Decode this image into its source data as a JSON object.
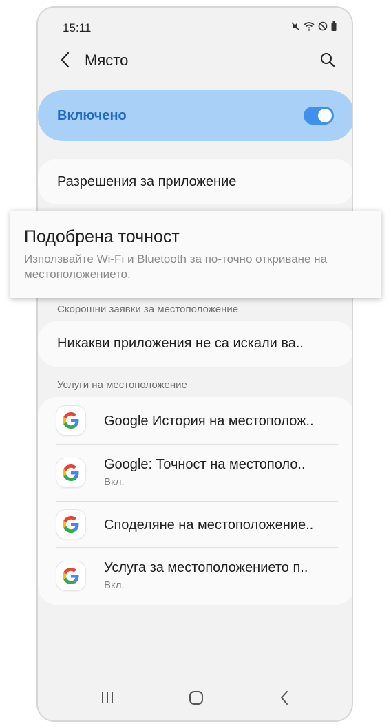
{
  "status_bar": {
    "time": "15:11",
    "icons": [
      "mute-icon",
      "wifi-icon",
      "block-icon",
      "battery-icon"
    ]
  },
  "header": {
    "title": "Място",
    "back_icon": "chevron-left-icon",
    "search_icon": "search-icon"
  },
  "master_switch": {
    "label": "Включено",
    "state": true,
    "accent_color": "#3e91ec",
    "background_color": "#a9d0f7"
  },
  "app_permissions": {
    "label": "Разрешения за приложение"
  },
  "improve_accuracy": {
    "title": "Подобрена точност",
    "subtitle": "Използвайте Wi-Fi и Bluetooth за по-точно откриване на местоположението."
  },
  "recent_requests": {
    "header": "Скорошни заявки за местоположение",
    "item": "Никакви приложения не са искали ва.."
  },
  "location_services": {
    "header": "Услуги на местоположение",
    "items": [
      {
        "title": "Google История на местополож..",
        "subtitle": ""
      },
      {
        "title": "Google: Точност на местополо..",
        "subtitle": "Вкл."
      },
      {
        "title": "Споделяне на местоположение..",
        "subtitle": ""
      },
      {
        "title": "Услуга за местоположението п..",
        "subtitle": "Вкл."
      }
    ]
  },
  "nav_bar": {
    "icons": [
      "recents-icon",
      "home-icon",
      "back-nav-icon"
    ]
  }
}
